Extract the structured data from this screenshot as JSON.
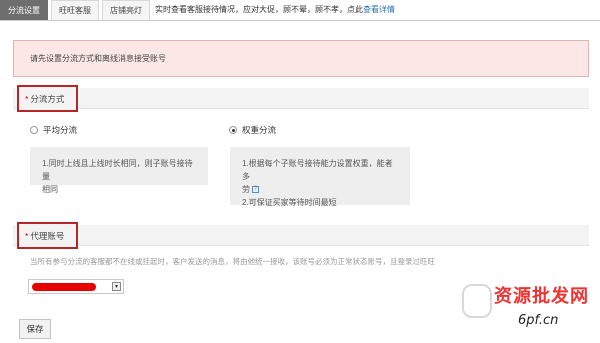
{
  "tabs": [
    {
      "label": "分流设置",
      "active": true
    },
    {
      "label": "旺旺客服",
      "active": false
    },
    {
      "label": "店铺亮灯",
      "active": false
    }
  ],
  "tab_note": "实时查看客服接待情况，应对大促，顾不晕，顾不孝，点此",
  "tab_note_link": "查看详情",
  "alert_text": "请先设置分流方式和离线消息接受账号",
  "section_diversion": {
    "star": "*",
    "label": "分流方式"
  },
  "radio_options": [
    {
      "label": "平均分流",
      "checked": false
    },
    {
      "label": "权重分流",
      "checked": true
    }
  ],
  "desc_average": [
    "1.同时上线且上线时长相同，则子账号接待量",
    "相同"
  ],
  "desc_weight": [
    "1.根据每个子账号接待能力设置权重，能者多",
    "劳",
    "2.可保证买家等待时间最短"
  ],
  "help_icon": "?",
  "section_proxy": {
    "star": "*",
    "label": "代理账号"
  },
  "proxy_hint": "当所有参与分流的客服都不在线或挂起时，客户发送的消息，将由他统一接收，该账号必须为正常状态账号，且登录过旺旺",
  "select_arrow": "▾",
  "save_label": "保存",
  "watermark": {
    "text": "资源批发网",
    "url": "6pf.cn"
  },
  "colors": {
    "highlight_border": "#b62626",
    "alert_bg": "#fbe8e6",
    "link": "#2a6db6",
    "redaction": "#e60000"
  }
}
